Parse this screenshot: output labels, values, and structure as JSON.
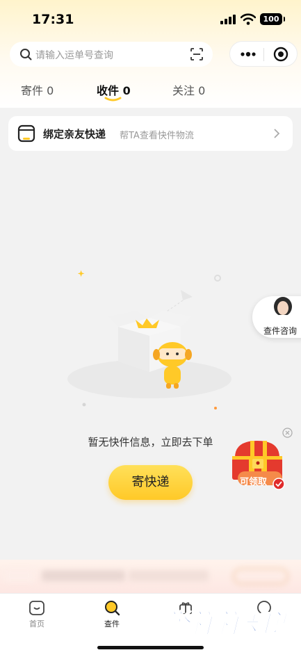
{
  "status_bar": {
    "time": "17:31",
    "battery": "100"
  },
  "search": {
    "placeholder": "请输入运单号查询"
  },
  "tabs": [
    {
      "label": "寄件",
      "count": "0"
    },
    {
      "label": "收件",
      "count": "0"
    },
    {
      "label": "关注",
      "count": "0"
    }
  ],
  "bind_card": {
    "title": "绑定亲友快递",
    "subtitle": "帮TA查看快件物流"
  },
  "empty_state": {
    "message": "暂无快件信息，立即去下单",
    "button_label": "寄快递"
  },
  "consult": {
    "label": "查件咨询"
  },
  "treasure": {
    "label": "可领取"
  },
  "tabbar": [
    {
      "label": "首页"
    },
    {
      "label": "查件"
    }
  ],
  "watermark": "誉祥祥知识",
  "colors": {
    "accent": "#ffc928",
    "accent_light": "#ffe05a",
    "treasure_red": "#e43a2e",
    "watermark_blue": "#1a4dbd"
  }
}
